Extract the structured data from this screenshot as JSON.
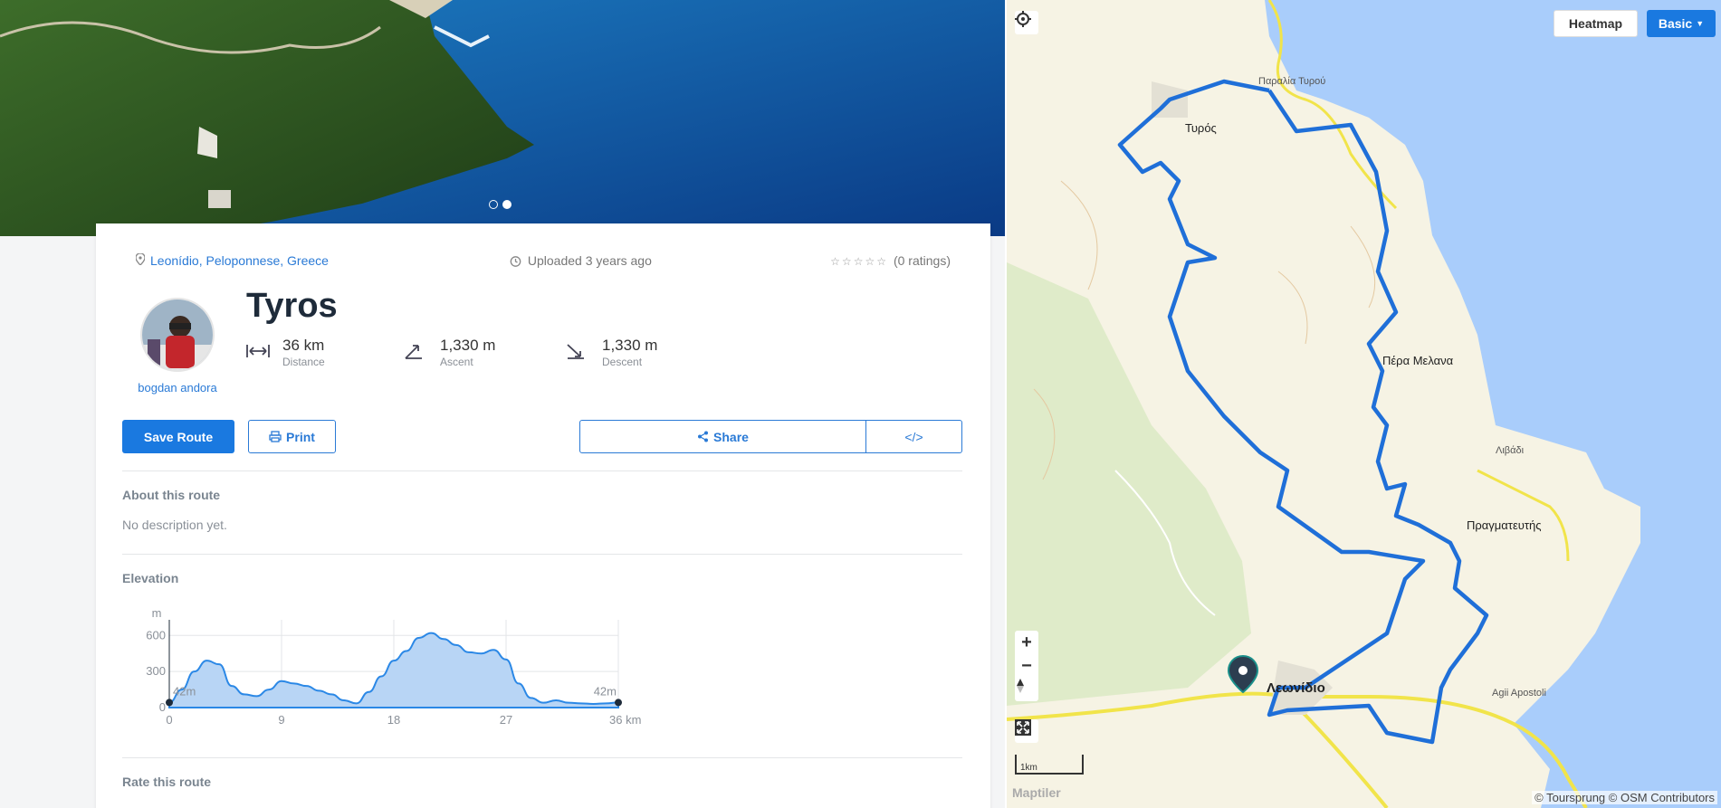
{
  "hero": {
    "slides": 2,
    "active_slide": 2
  },
  "route": {
    "location": "Leonídio, Peloponnese, Greece",
    "uploaded": "Uploaded 3 years ago",
    "ratings": "(0 ratings)",
    "title": "Tyros",
    "author": "bogdan andora",
    "stats": {
      "distance": {
        "value": "36 km",
        "label": "Distance"
      },
      "ascent": {
        "value": "1,330 m",
        "label": "Ascent"
      },
      "descent": {
        "value": "1,330 m",
        "label": "Descent"
      }
    }
  },
  "buttons": {
    "save": "Save Route",
    "print": "Print",
    "share": "Share",
    "embed": "</>"
  },
  "about": {
    "heading": "About this route",
    "text": "No description yet."
  },
  "elevation": {
    "heading": "Elevation",
    "unit": "m",
    "start_label": "42m",
    "end_label": "42m",
    "y_ticks": [
      "600",
      "300",
      "0"
    ],
    "x_ticks": [
      "0",
      "9",
      "18",
      "27",
      "36 km"
    ]
  },
  "rate": {
    "heading": "Rate this route"
  },
  "chart_data": {
    "type": "area",
    "xlabel": "",
    "ylabel": "m",
    "xlim": [
      0,
      36
    ],
    "ylim": [
      0,
      700
    ],
    "x_unit": "km",
    "x": [
      0,
      1,
      2,
      3,
      4,
      5,
      6,
      7,
      8,
      9,
      10,
      11,
      12,
      13,
      14,
      15,
      16,
      17,
      18,
      19,
      20,
      21,
      22,
      23,
      24,
      25,
      26,
      27,
      28,
      29,
      30,
      31,
      32,
      33,
      34,
      35,
      36
    ],
    "values": [
      42,
      150,
      300,
      390,
      360,
      180,
      110,
      95,
      150,
      220,
      200,
      180,
      140,
      110,
      60,
      35,
      130,
      260,
      390,
      470,
      580,
      620,
      570,
      520,
      460,
      450,
      480,
      400,
      200,
      80,
      40,
      60,
      40,
      35,
      30,
      35,
      42
    ]
  },
  "map": {
    "heatmap_button": "Heatmap",
    "style_button": "Basic",
    "labels": {
      "paralia": "Παραλία Τυρού",
      "tyros": "Τυρός",
      "pera": "Πέρα Μελανα",
      "livadi": "Λιβάδι",
      "pragmateftis": "Πραγματευτής",
      "leonidio": "Λεωνίδιο",
      "agii": "Agii Apostoli"
    },
    "zoom_in": "+",
    "zoom_out": "−",
    "scale": "1km",
    "logo": "Maptiler",
    "attribution": "© Toursprung © OSM Contributors",
    "colors": {
      "route": "#1f6fd8",
      "sea": "#a9cdfb",
      "road": "#f1e44a",
      "land": "#f6f3e4"
    }
  }
}
